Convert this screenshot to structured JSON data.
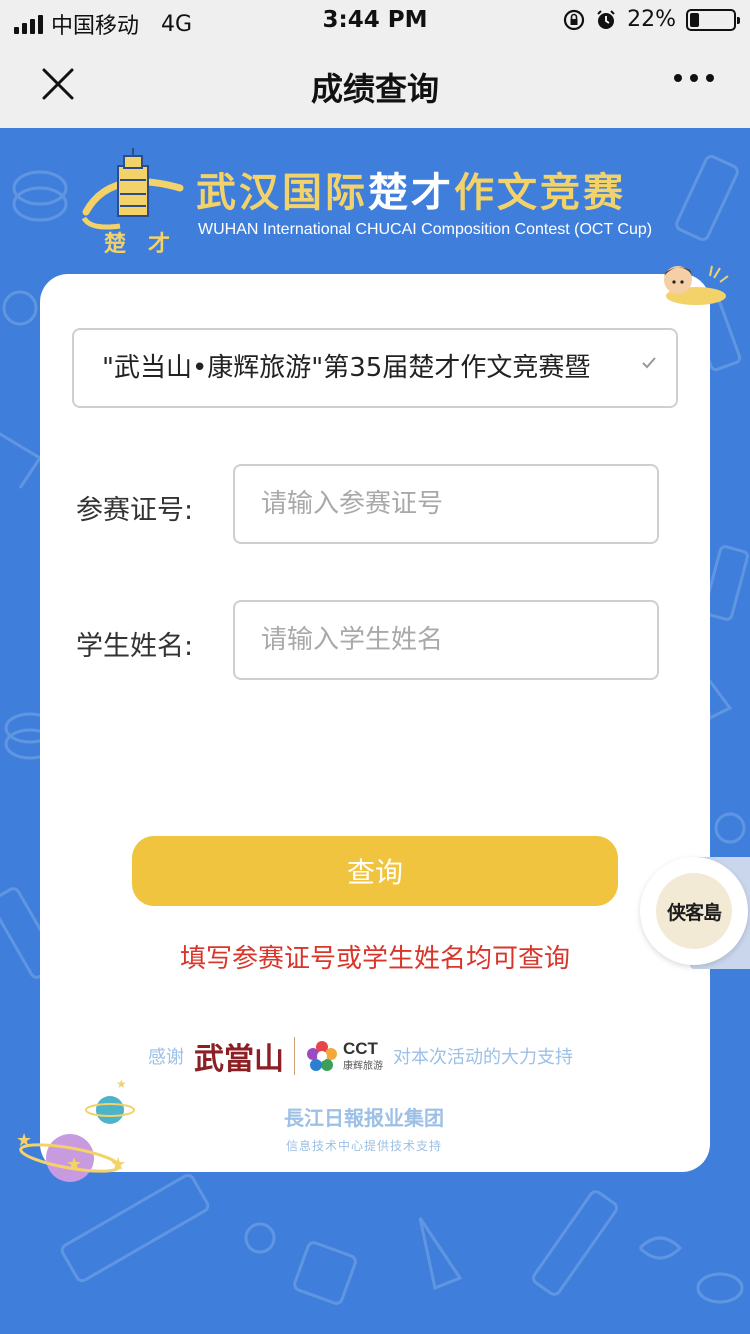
{
  "status_bar": {
    "carrier": "中国移动",
    "network": "4G",
    "time": "3:44 PM",
    "battery": "22%",
    "battery_level": 0.22
  },
  "nav": {
    "title": "成绩查询",
    "close_icon": "close-icon",
    "more_icon": "more-icon"
  },
  "header": {
    "title_part1": "武汉国际",
    "title_part2": "楚才",
    "title_part3": "作文竞赛",
    "subtitle_en": "WUHAN International CHUCAI Composition Contest (OCT Cup)",
    "logo_text": "楚才"
  },
  "form": {
    "contest_select": "\"武当山•康辉旅游\"第35届楚才作文竞赛暨",
    "id_label": "参赛证号:",
    "id_placeholder": "请输入参赛证号",
    "name_label": "学生姓名:",
    "name_placeholder": "请输入学生姓名",
    "query_button": "查询",
    "hint": "填写参赛证号或学生姓名均可查询"
  },
  "footer": {
    "thanks_prefix": "感谢",
    "sponsor1": "武當山",
    "sponsor2": "CCT",
    "sponsor2_sub": "康辉旅游",
    "thanks_suffix": "对本次活动的大力支持",
    "press_name": "長江日報报业集团",
    "press_note": "信息技术中心提供技术支持"
  },
  "floating": {
    "badge_text": "侠客島"
  },
  "colors": {
    "background": "#3f7fdb",
    "button": "#f0c43f",
    "hint": "#d9362b",
    "header_gold": "#f3d26a"
  }
}
